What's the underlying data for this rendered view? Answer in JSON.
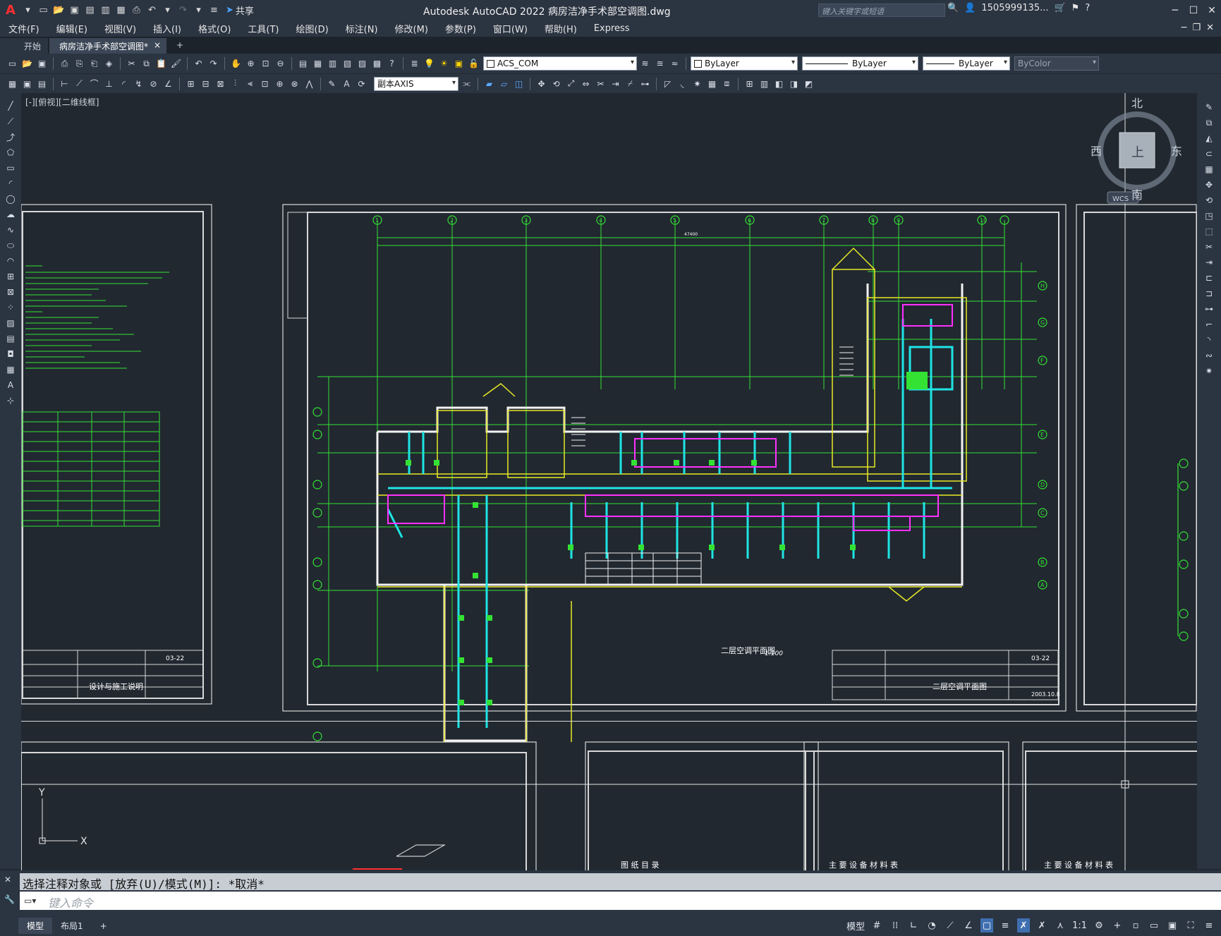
{
  "app": {
    "title": "Autodesk AutoCAD 2022    病房洁净手术部空调图.dwg",
    "share_label": "共享",
    "search_placeholder": "键入关键字或短语",
    "user": "1505999135...",
    "logo": "A"
  },
  "menu": [
    "文件(F)",
    "编辑(E)",
    "视图(V)",
    "插入(I)",
    "格式(O)",
    "工具(T)",
    "绘图(D)",
    "标注(N)",
    "修改(M)",
    "参数(P)",
    "窗口(W)",
    "帮助(H)",
    "Express"
  ],
  "tabs": {
    "start": "开始",
    "active": "病房洁净手术部空调图*",
    "close": "×",
    "plus": "+"
  },
  "toolbar": {
    "layer": "ACS_COM",
    "color": "ByLayer",
    "linetype": "ByLayer",
    "lineweight": "ByLayer",
    "plotstyle": "ByColor",
    "dimstyle": "副本AXIS"
  },
  "viewport": {
    "label": "[-][俯视][二维线框]",
    "compass": {
      "north": "北",
      "south": "南",
      "east": "东",
      "west": "西",
      "top": "上",
      "wcs": "WCS"
    },
    "ucs_y": "Y",
    "ucs_x": "X"
  },
  "drawing": {
    "left_sheet_title": "设计与施工说明",
    "main_plan_title": "二层空调平面图",
    "main_plan_scale": "1:100",
    "sheet_no_left": "03-22",
    "sheet_no_main": "03-22",
    "sheet_date": "2003.10.8",
    "bottom_sheet_1": "图 纸 目 录",
    "bottom_sheet_2": "主 要 设 备 材 料 表",
    "bottom_sheet_3": "主 要 设 备 材 料 表",
    "axis_top": [
      "1",
      "2",
      "3",
      "4",
      "5",
      "6",
      "7",
      "8",
      "9",
      "10"
    ],
    "axis_right": [
      "H",
      "G",
      "F",
      "E",
      "D",
      "C",
      "B",
      "A"
    ],
    "overall_dim": "47400"
  },
  "command": {
    "history": "选择注释对象或 [放弃(U)/模式(M)]: *取消*",
    "prompt": "键入命令"
  },
  "status": {
    "model_tab": "模型",
    "layout_tab": "布局1",
    "add": "+",
    "model_label": "模型",
    "scale": "1:1"
  }
}
